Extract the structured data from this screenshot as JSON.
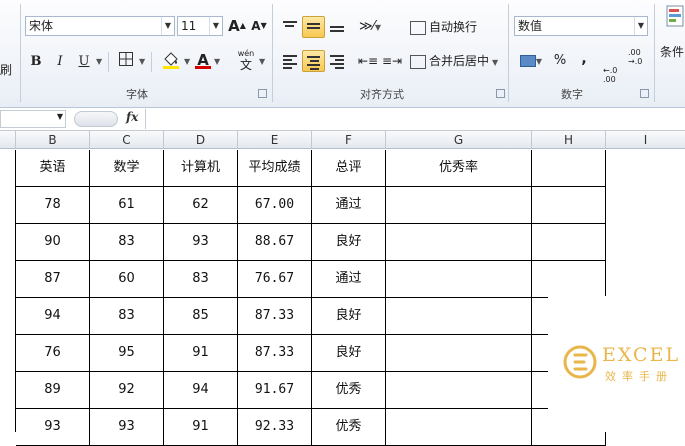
{
  "ribbon": {
    "font": {
      "name": "宋体",
      "size": "11",
      "grow": "A",
      "shrink": "A",
      "bold": "B",
      "italic": "I",
      "underline": "U",
      "color_letter": "A",
      "wen": "wén",
      "label": "字体"
    },
    "align": {
      "wrap_label": "自动换行",
      "merge_label": "合并后居中",
      "label": "对齐方式"
    },
    "number": {
      "format": "数值",
      "percent": "%",
      "comma": ",",
      "inc_decimal": ".0\n.00",
      "label": "数字"
    },
    "styles": {
      "conditional": "条件"
    },
    "left_clip": "刷",
    "colors": {
      "fill": "#ffe600",
      "font": "#d40000",
      "accent": "#f5c242"
    }
  },
  "formula_bar": {
    "fx": "fx"
  },
  "columns": [
    "B",
    "C",
    "D",
    "E",
    "F",
    "G",
    "H",
    "I"
  ],
  "table": {
    "headers": [
      "英语",
      "数学",
      "计算机",
      "平均成绩",
      "总评",
      "优秀率"
    ],
    "rows": [
      [
        "78",
        "61",
        "62",
        "67.00",
        "通过",
        ""
      ],
      [
        "90",
        "83",
        "93",
        "88.67",
        "良好",
        ""
      ],
      [
        "87",
        "60",
        "83",
        "76.67",
        "通过",
        ""
      ],
      [
        "94",
        "83",
        "85",
        "87.33",
        "良好",
        ""
      ],
      [
        "76",
        "95",
        "91",
        "87.33",
        "良好",
        ""
      ],
      [
        "89",
        "92",
        "94",
        "91.67",
        "优秀",
        ""
      ],
      [
        "93",
        "93",
        "91",
        "92.33",
        "优秀",
        ""
      ]
    ]
  },
  "watermark": {
    "brand": "EXCEL",
    "sub": "效率手册"
  }
}
